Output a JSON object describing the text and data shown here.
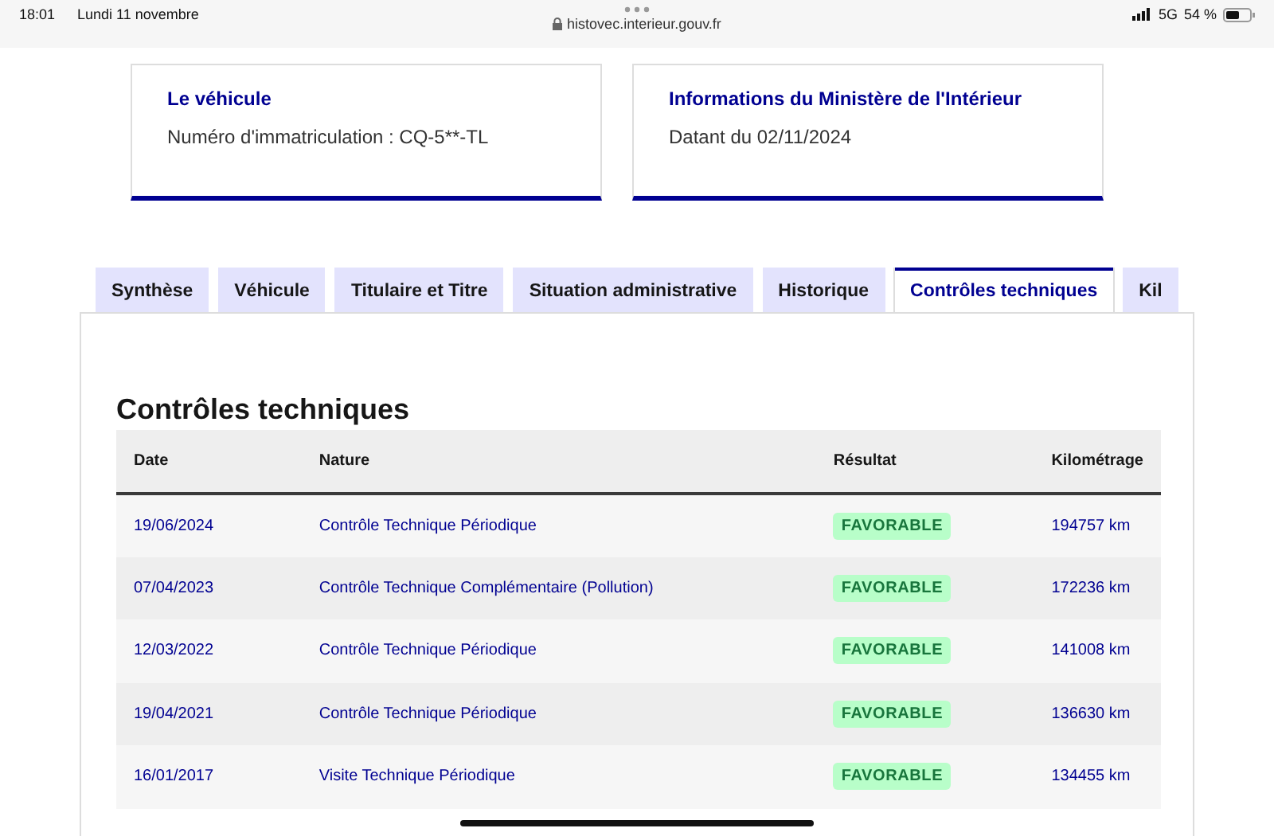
{
  "status_bar": {
    "time": "18:01",
    "date": "Lundi 11 novembre",
    "url": "histovec.interieur.gouv.fr",
    "network": "5G",
    "battery": "54 %"
  },
  "cards": [
    {
      "title": "Le véhicule",
      "text": "Numéro d'immatriculation : CQ-5**-TL"
    },
    {
      "title": "Informations du Ministère de l'Intérieur",
      "text": "Datant du 02/11/2024"
    }
  ],
  "tabs": [
    {
      "label": "Synthèse",
      "selected": false
    },
    {
      "label": "Véhicule",
      "selected": false
    },
    {
      "label": "Titulaire et Titre",
      "selected": false
    },
    {
      "label": "Situation administrative",
      "selected": false
    },
    {
      "label": "Historique",
      "selected": false
    },
    {
      "label": "Contrôles techniques",
      "selected": true
    },
    {
      "label": "Kil",
      "selected": false
    }
  ],
  "section_title": "Contrôles techniques",
  "table": {
    "columns": [
      "Date",
      "Nature",
      "Résultat",
      "Kilométrage"
    ],
    "rows": [
      {
        "date": "19/06/2024",
        "nature": "Contrôle Technique Périodique",
        "result": "FAVORABLE",
        "mileage": "194757 km"
      },
      {
        "date": "07/04/2023",
        "nature": "Contrôle Technique Complémentaire (Pollution)",
        "result": "FAVORABLE",
        "mileage": "172236 km"
      },
      {
        "date": "12/03/2022",
        "nature": "Contrôle Technique Périodique",
        "result": "FAVORABLE",
        "mileage": "141008 km"
      },
      {
        "date": "19/04/2021",
        "nature": "Contrôle Technique Périodique",
        "result": "FAVORABLE",
        "mileage": "136630 km"
      },
      {
        "date": "16/01/2017",
        "nature": "Visite Technique Périodique",
        "result": "FAVORABLE",
        "mileage": "134455 km"
      }
    ]
  }
}
